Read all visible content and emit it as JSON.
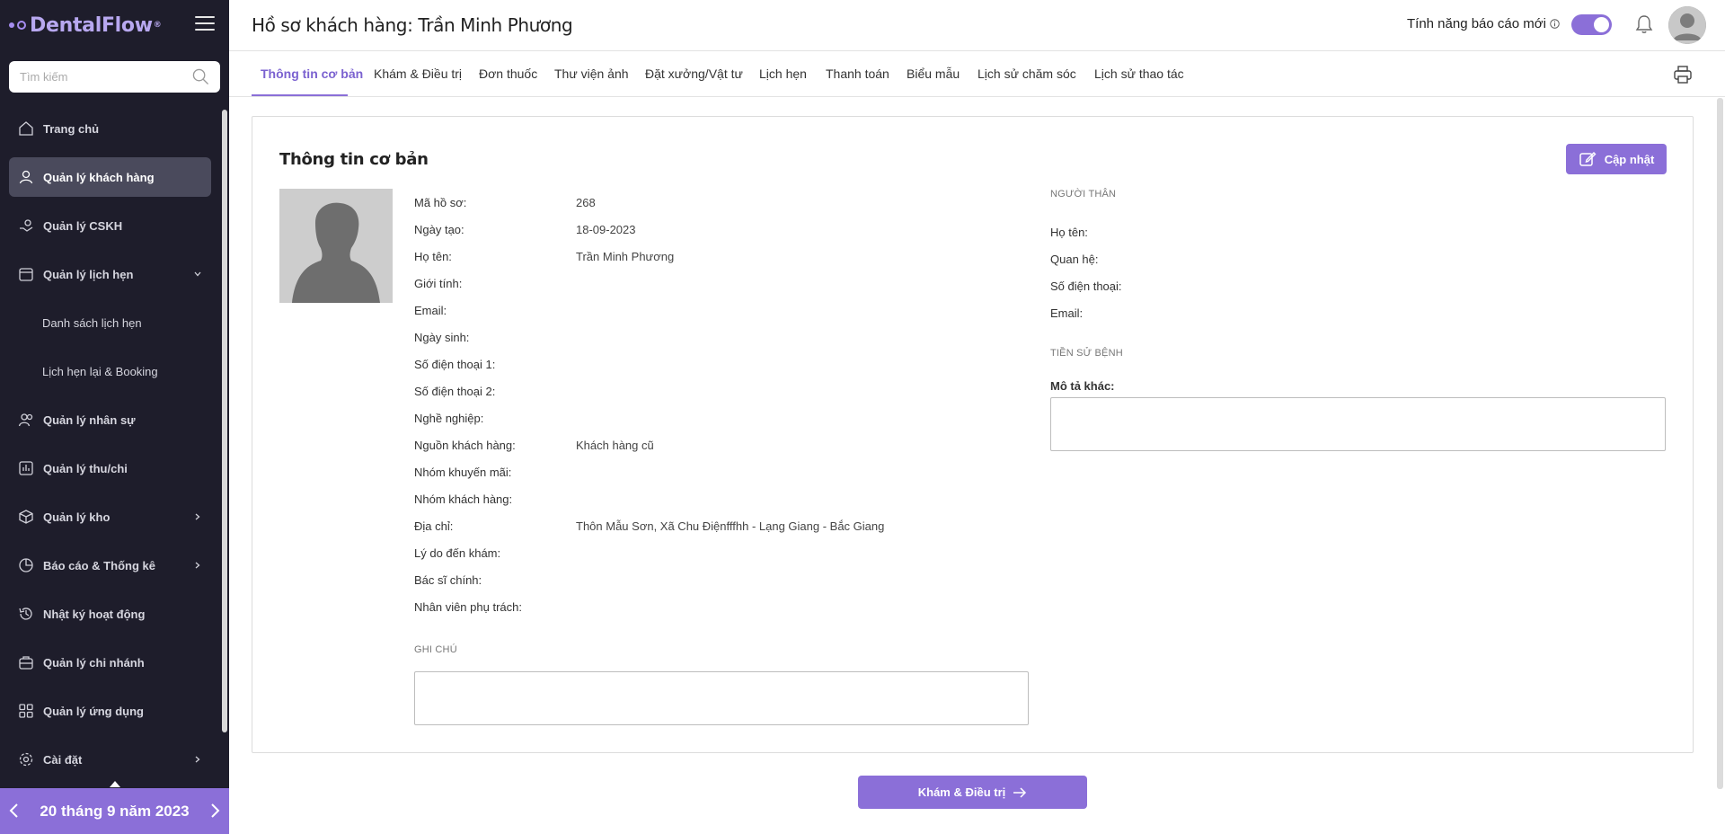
{
  "brand": {
    "name": "DentalFlow",
    "mark": "®",
    "accent": "#8b6fd8",
    "sidebar_bg": "#1e1d2b"
  },
  "search": {
    "placeholder": "Tìm kiếm",
    "value": ""
  },
  "sidebar": {
    "items": [
      {
        "label": "Trang chủ",
        "icon": "home-icon"
      },
      {
        "label": "Quản lý khách hàng",
        "icon": "user-icon",
        "active": true
      },
      {
        "label": "Quản lý CSKH",
        "icon": "care-icon"
      },
      {
        "label": "Quản lý lịch hẹn",
        "icon": "calendar-icon",
        "chevron": "down"
      },
      {
        "label": "Danh sách lịch hẹn",
        "sub": true
      },
      {
        "label": "Lịch hẹn lại & Booking",
        "sub": true
      },
      {
        "label": "Quản lý nhân sự",
        "icon": "users-icon"
      },
      {
        "label": "Quản lý thu/chi",
        "icon": "finance-icon"
      },
      {
        "label": "Quản lý kho",
        "icon": "box-icon",
        "chevron": "right"
      },
      {
        "label": "Báo cáo & Thống kê",
        "icon": "chart-icon",
        "chevron": "right"
      },
      {
        "label": "Nhật ký hoạt động",
        "icon": "history-icon"
      },
      {
        "label": "Quản lý chi nhánh",
        "icon": "branch-icon"
      },
      {
        "label": "Quản lý ứng dụng",
        "icon": "apps-icon"
      },
      {
        "label": "Cài đặt",
        "icon": "settings-icon",
        "chevron": "right"
      }
    ]
  },
  "date_bar": {
    "label": "20 tháng 9 năm 2023"
  },
  "header": {
    "title": "Hồ sơ khách hàng: Trần Minh Phương",
    "feature_label": "Tính năng báo cáo mới",
    "toggle_on": true
  },
  "tabs": [
    {
      "label": "Thông tin cơ bản",
      "active": true
    },
    {
      "label": "Khám & Điều trị"
    },
    {
      "label": "Đơn thuốc"
    },
    {
      "label": "Thư viện ảnh"
    },
    {
      "label": "Đặt xưởng/Vật tư"
    },
    {
      "label": "Lịch hẹn"
    },
    {
      "label": "Thanh toán"
    },
    {
      "label": "Biểu mẫu"
    },
    {
      "label": "Lịch sử chăm sóc"
    },
    {
      "label": "Lịch sử thao tác"
    }
  ],
  "card": {
    "title": "Thông tin cơ bản",
    "update_label": "Cập nhật",
    "fields": [
      {
        "label": "Mã hồ sơ:",
        "value": "268"
      },
      {
        "label": "Ngày tạo:",
        "value": "18-09-2023"
      },
      {
        "label": "Họ tên:",
        "value": "Trần Minh Phương"
      },
      {
        "label": "Giới tính:",
        "value": ""
      },
      {
        "label": "Email:",
        "value": ""
      },
      {
        "label": "Ngày sinh:",
        "value": ""
      },
      {
        "label": "Số điện thoại 1:",
        "value": ""
      },
      {
        "label": "Số điện thoại 2:",
        "value": ""
      },
      {
        "label": "Nghề nghiệp:",
        "value": ""
      },
      {
        "label": "Nguồn khách hàng:",
        "value": "Khách hàng cũ"
      },
      {
        "label": "Nhóm khuyến mãi:",
        "value": ""
      },
      {
        "label": "Nhóm khách hàng:",
        "value": ""
      },
      {
        "label": "Địa chỉ:",
        "value": "Thôn Mẫu Sơn, Xã Chu Điệnfffhh - Lạng Giang - Bắc Giang"
      },
      {
        "label": "Lý do đến khám:",
        "value": ""
      },
      {
        "label": "Bác sĩ chính:",
        "value": ""
      },
      {
        "label": "Nhân viên phụ trách:",
        "value": ""
      }
    ],
    "note_label": "GHI CHÚ",
    "note_value": "",
    "relative": {
      "section_label": "NGƯỜI THÂN",
      "name_label": "Họ tên:",
      "relation_label": "Quan hệ:",
      "phone_label": "Số điện thoại:",
      "email_label": "Email:"
    },
    "medical": {
      "section_label": "TIỀN SỬ BỆNH",
      "desc_label": "Mô tả khác:",
      "desc_value": ""
    }
  },
  "footer_button": {
    "label": "Khám & Điều trị"
  }
}
